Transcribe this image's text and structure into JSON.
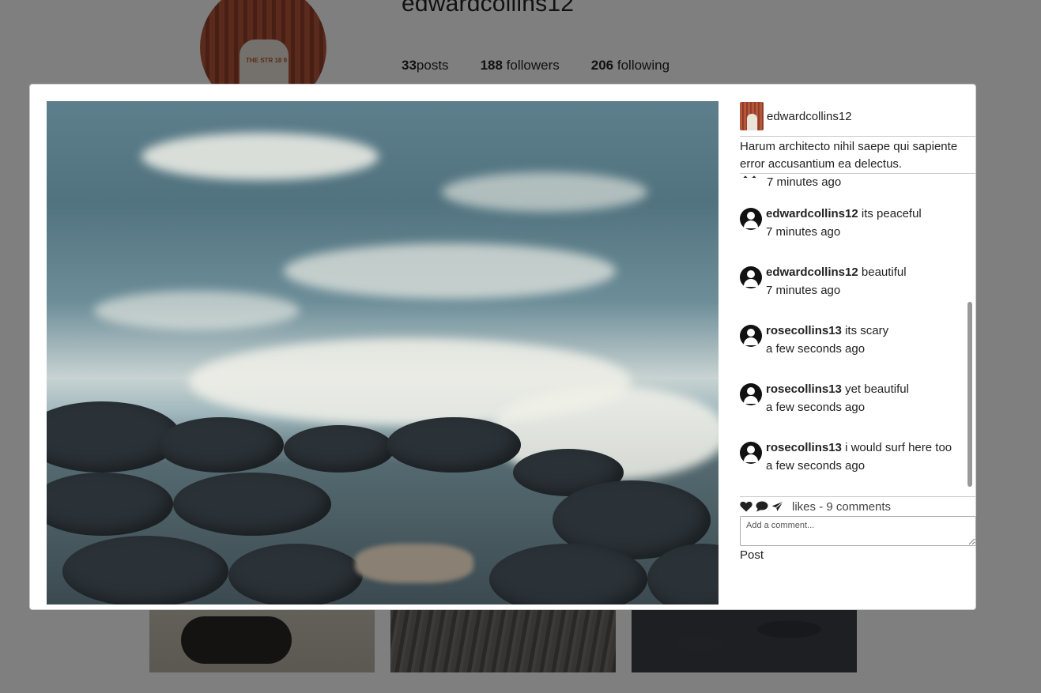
{
  "profile": {
    "username": "edwardcollins12",
    "stats": {
      "posts_count": "33",
      "posts_label": "posts",
      "followers_count": "188",
      "followers_label": "followers",
      "following_count": "206",
      "following_label": "following"
    }
  },
  "modal": {
    "author": "edwardcollins12",
    "caption": "Harum architecto nihil saepe qui sapiente error accusantium ea delectus.",
    "partial_comment_time": "7 minutes ago",
    "comments": [
      {
        "user": "edwardcollins12",
        "text": "its peaceful",
        "time": "7 minutes ago"
      },
      {
        "user": "edwardcollins12",
        "text": "beautiful",
        "time": "7 minutes ago"
      },
      {
        "user": "rosecollins13",
        "text": "its scary",
        "time": "a few seconds ago"
      },
      {
        "user": "rosecollins13",
        "text": "yet beautiful",
        "time": "a few seconds ago"
      },
      {
        "user": "rosecollins13",
        "text": "i would surf here too",
        "time": "a few seconds ago"
      }
    ],
    "likes_label": "likes",
    "separator": "-",
    "comments_count_label": "9 comments",
    "comment_placeholder": "Add a comment...",
    "post_label": "Post"
  }
}
